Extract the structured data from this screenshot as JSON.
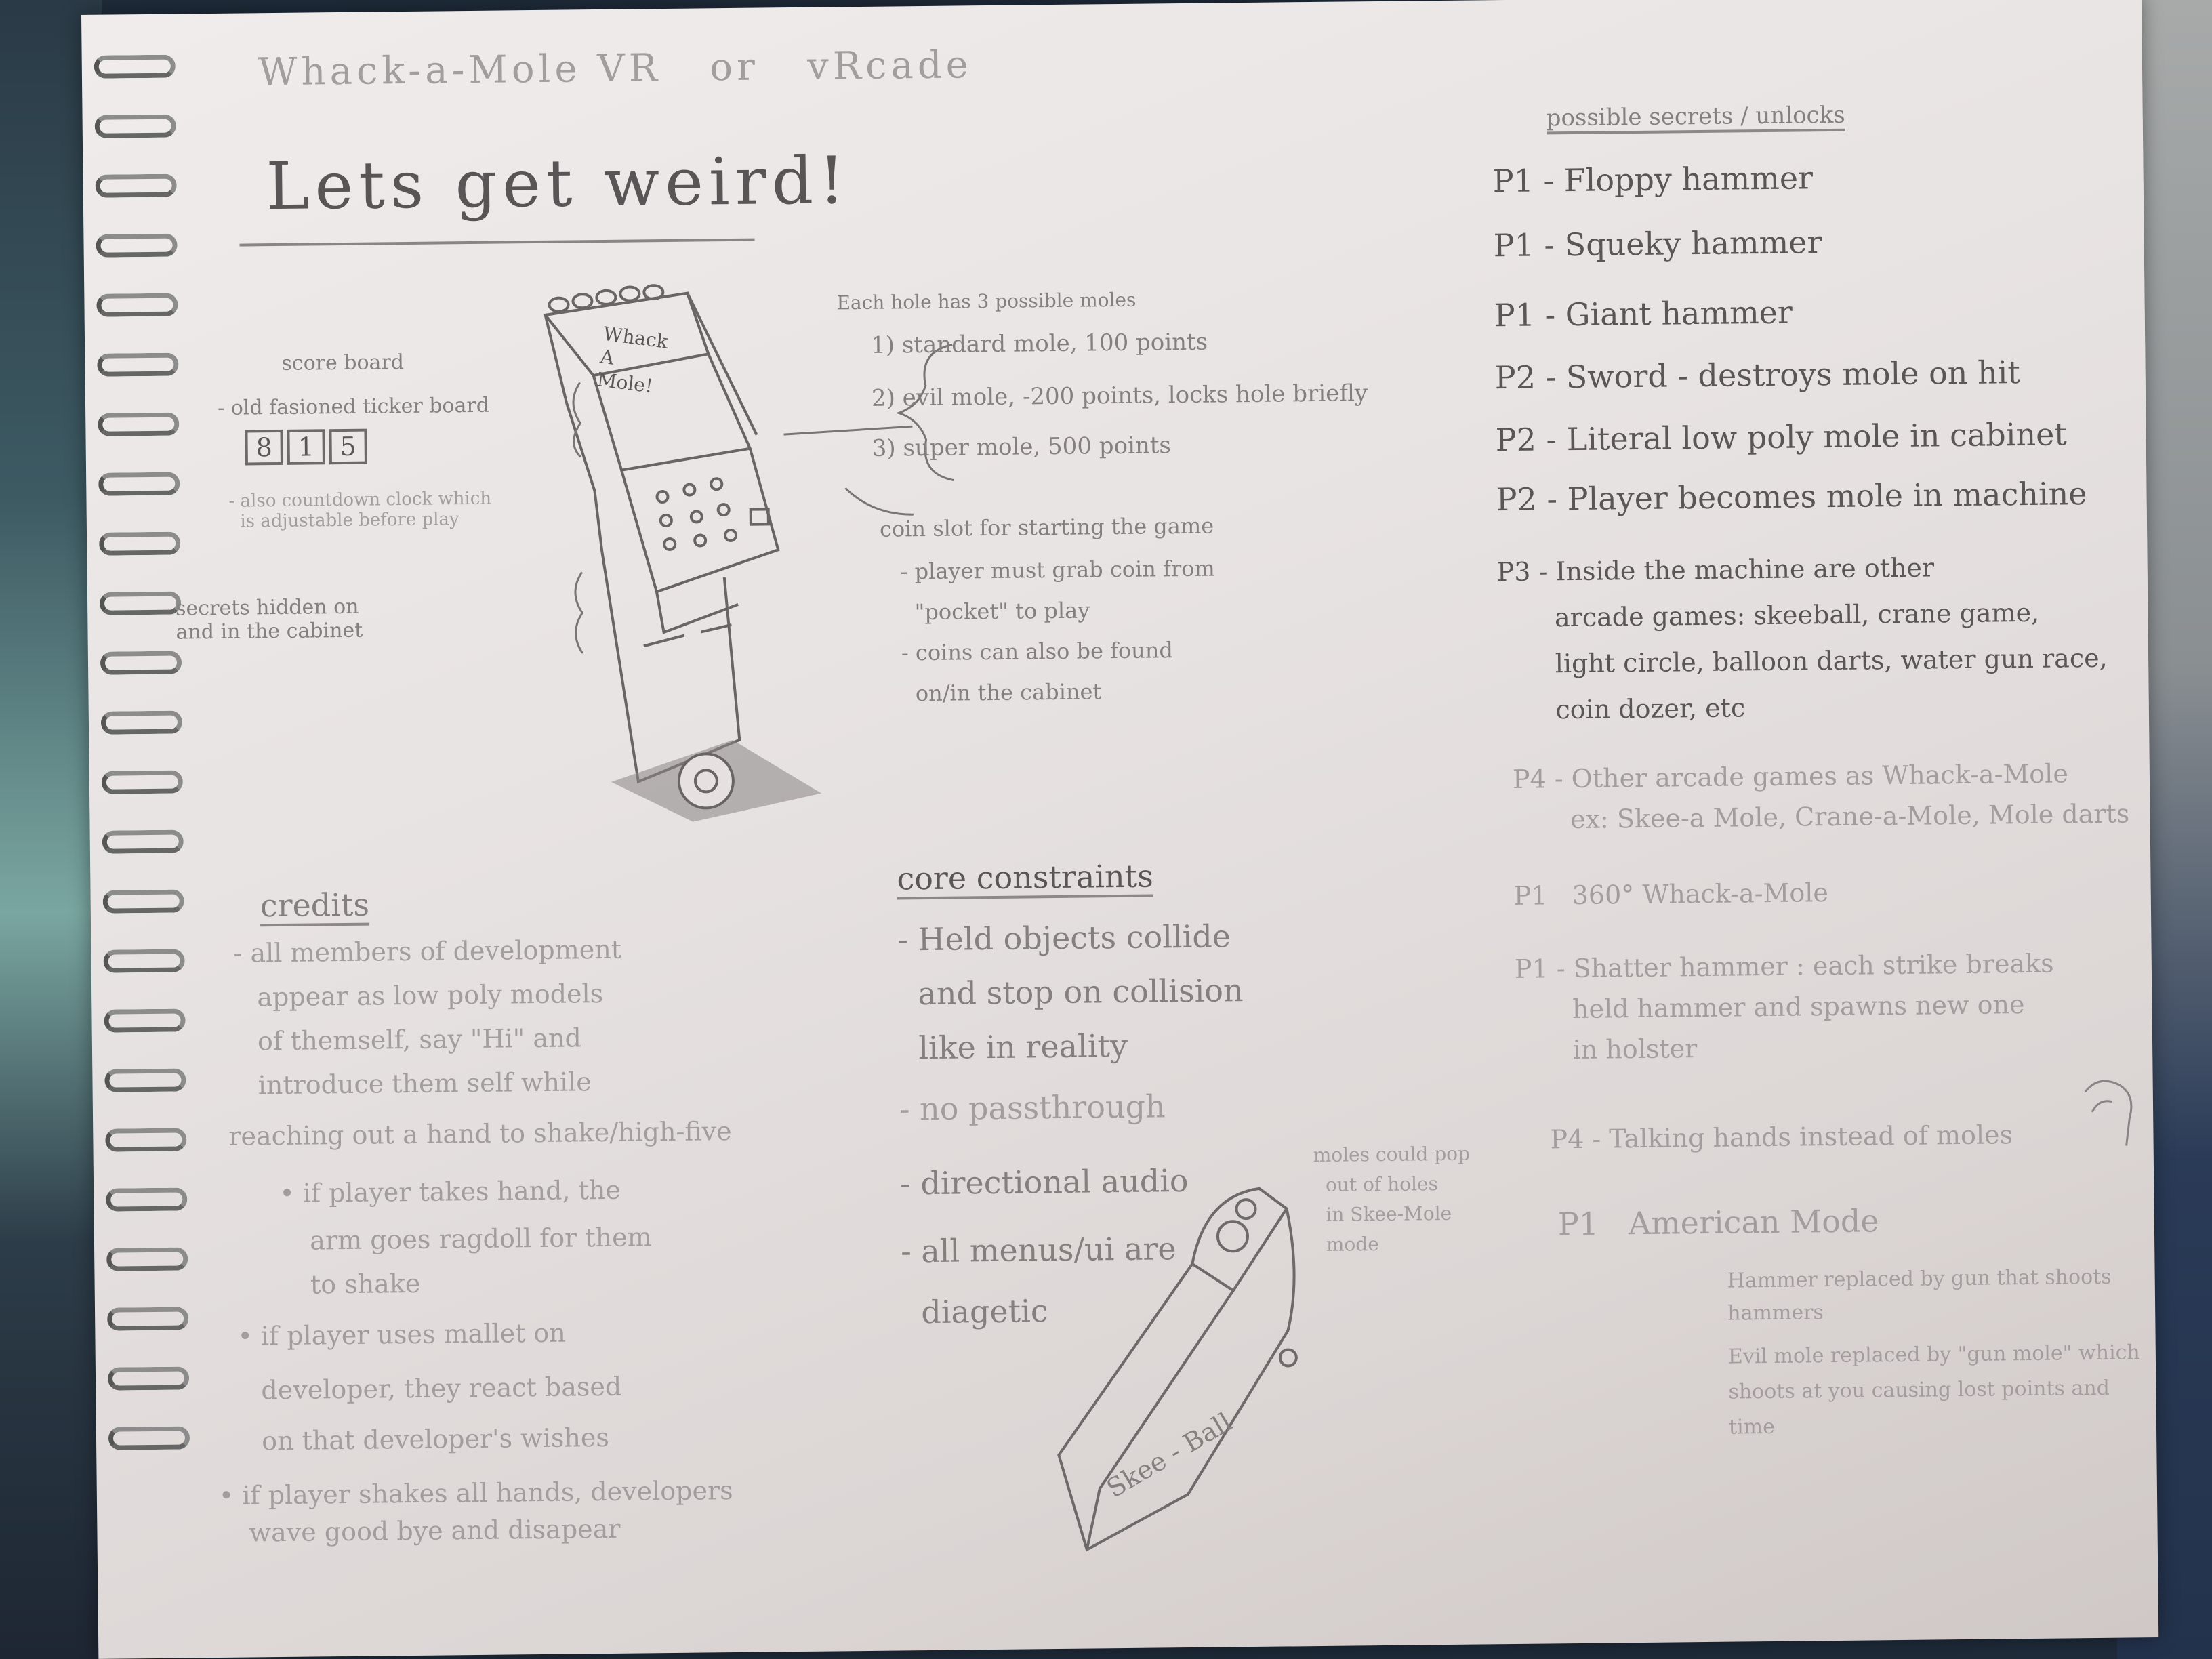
{
  "title": "Whack-a-Mole VR   or   vRcade",
  "headline": "Lets get weird!",
  "score_board": {
    "label": "score board",
    "ticker": "- old fasioned ticker board",
    "digits": [
      "8",
      "1",
      "5"
    ],
    "clock": "- also countdown clock which\n  is adjustable before play"
  },
  "cabinet_sign": "Whack\nA\nMole!",
  "secrets_note": "secrets hidden on\nand in the cabinet",
  "moles": {
    "intro": "Each hole has 3 possible moles",
    "items": [
      "1) standard mole, 100 points",
      "2) evil mole, -200 points, locks hole briefly",
      "3) super mole, 500 points"
    ]
  },
  "coin_slot": {
    "title": "coin slot for starting the game",
    "lines": [
      "- player must grab coin from",
      "  \"pocket\" to play",
      "- coins can also be found",
      "  on/in the cabinet"
    ]
  },
  "unlocks": {
    "heading": "possible secrets / unlocks",
    "items": [
      "P1 - Floppy hammer",
      "P1 - Squeky hammer",
      "P1 - Giant hammer",
      "P2 - Sword - destroys mole on hit",
      "P2 - Literal low poly mole in cabinet",
      "P2 - Player becomes mole in machine",
      "P3 - Inside the machine are other\n       arcade games: skeeball, crane game,\n       light circle, balloon darts, water gun race,\n       coin dozer, etc",
      "P4 - Other arcade games as Whack-a-Mole\n       ex: Skee-a Mole, Crane-a-Mole, Mole darts",
      "P1   360° Whack-a-Mole",
      "P1 - Shatter hammer : each strike breaks\n       held hammer and spawns new one\n       in holster",
      "P4 - Talking hands instead of moles",
      "P1   American Mode",
      "  Hammer replaced by gun that shoots\n  hammers",
      "  Evil mole replaced by \"gun mole\" which\n  shoots at you causing lost points and\n  time"
    ]
  },
  "credits": {
    "heading": "credits",
    "lines": [
      "- all members of development",
      "  appear as low poly models",
      "  of themself, say \"Hi\" and",
      "  introduce them self while",
      "reaching out a hand to shake/high-five",
      "  • if player takes hand, the",
      "    arm goes ragdoll for them",
      "    to shake",
      "• if player uses mallet on",
      "  developer, they react based",
      "  on that developer's wishes",
      "• if player shakes all hands, developers",
      "  wave good bye and disapear"
    ]
  },
  "constraints": {
    "heading": "core constraints",
    "lines": [
      "- Held objects collide",
      "  and stop on collision",
      "  like in reality",
      "- no passthrough",
      "- directional audio",
      "- all menus/ui are",
      "  diagetic"
    ]
  },
  "skee": {
    "label": "Skee - Ball",
    "note": "moles could pop\n  out of holes\n  in Skee-Mole\n  mode"
  }
}
